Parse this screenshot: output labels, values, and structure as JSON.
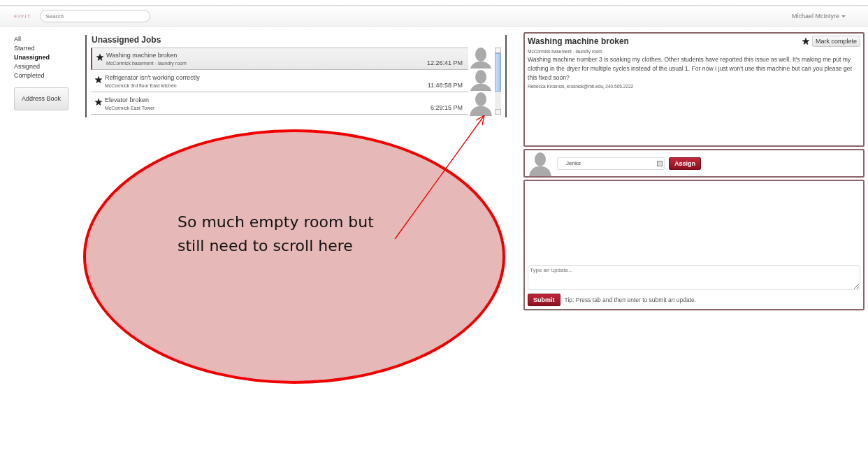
{
  "header": {
    "logo": "FIYIT",
    "search": {
      "placeholder": "Search"
    },
    "user": "Michael McIntyre"
  },
  "sidebar": {
    "items": [
      {
        "label": "All",
        "selected": false
      },
      {
        "label": "Starred",
        "selected": false
      },
      {
        "label": "Unassigned",
        "selected": true
      },
      {
        "label": "Assigned",
        "selected": false
      },
      {
        "label": "Completed",
        "selected": false
      }
    ],
    "address_book": "Address Book"
  },
  "jobs": {
    "title": "Unassigned Jobs",
    "items": [
      {
        "title": "Washing machine broken",
        "location": "McCormick basement - laundry room",
        "time": "12:26:41 PM",
        "starred": true,
        "selected": true
      },
      {
        "title": "Refrigerator isn't working correctly",
        "location": "McCormick 3rd floor East kitchen",
        "time": "11:48:58 PM",
        "starred": true,
        "selected": false
      },
      {
        "title": "Elevator broken",
        "location": "McCormick East Tower",
        "time": "6:29:15 PM",
        "starred": true,
        "selected": false
      }
    ]
  },
  "detail": {
    "title": "Washing machine broken",
    "location": "McCormick basement - laundry room",
    "starred": true,
    "mark_complete": "Mark complete",
    "description": "Washing machine number 3 is soaking my clothes. Other students have reported this issue as well. It's making me put my clothing in the dryer for multiple cycles instead of the usual 1. For now I just won't use this machine but can you please get this fixed soon?",
    "contact": "Rebecca Krosnick, krosnick@mit.edu, 240.505.2222"
  },
  "assign": {
    "assignee": "Jenks",
    "button": "Assign"
  },
  "updates": {
    "placeholder": "Type an update...",
    "submit": "Submit",
    "tip": "Tip: Press tab and then enter to submit an update."
  },
  "annotation": {
    "text": "So much empty room but still need to scroll here"
  }
}
